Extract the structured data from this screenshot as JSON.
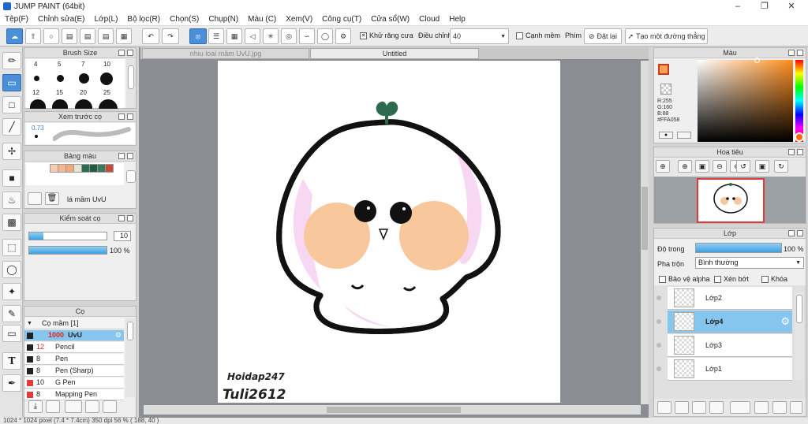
{
  "window": {
    "title": "JUMP PAINT (64bit)"
  },
  "menu": [
    "Tệp(F)",
    "Chỉnh sửa(E)",
    "Lớp(L)",
    "Bộ lọc(R)",
    "Chọn(S)",
    "Chụp(N)",
    "Màu (C)",
    "Xem(V)",
    "Công cụ(T)",
    "Cửa sổ(W)",
    "Cloud",
    "Help"
  ],
  "toolbar": {
    "antialias_label": "Khử răng cưa",
    "adjust_label": "Điều chỉnh",
    "adjust_value": "40",
    "soft_edge_label": "Cạnh mềm",
    "key_label": "Phím",
    "reset_label": "Đặt lại",
    "straight_line_label": "Tạo một đường thẳng"
  },
  "tabs": [
    {
      "label": "nhiu loai mầm UvU.jpg"
    },
    {
      "label": "Untitled"
    }
  ],
  "brush_size": {
    "title": "Brush Size",
    "row1": [
      "4",
      "5",
      "7",
      "10"
    ],
    "row2": [
      "12",
      "15",
      "20",
      "25"
    ]
  },
  "preview": {
    "title": "Xem trước cọ",
    "value": "0.73"
  },
  "palette": {
    "title": "Bảng màu",
    "name": "lá mầm UvU",
    "colors": [
      "#f6cdb0",
      "#f4b78e",
      "#f2a97a",
      "#e8e2d4",
      "#2d6b50",
      "#245a42",
      "#3a7a5c",
      "#c24b3e"
    ]
  },
  "brush_control": {
    "title": "Kiểm soát cọ",
    "size": "10",
    "opacity": "100 %"
  },
  "brushes": {
    "title": "Cọ",
    "group": "Cọ mầm [1]",
    "items": [
      {
        "num": "1000",
        "name": "UvU",
        "color": "#222222",
        "selected": true
      },
      {
        "num": "12",
        "name": "Pencil",
        "color": "#222222"
      },
      {
        "num": "8",
        "name": "Pen",
        "color": "#222222"
      },
      {
        "num": "8",
        "name": "Pen (Sharp)",
        "color": "#222222"
      },
      {
        "num": "10",
        "name": "G Pen",
        "color": "#e23b3b"
      },
      {
        "num": "8",
        "name": "Mapping Pen",
        "color": "#e23b3b"
      }
    ]
  },
  "color_panel": {
    "title": "Màu",
    "r": "R:255",
    "g": "G:160",
    "b": "B:88",
    "hex": "#FFA058",
    "fg_color": "#FFA058"
  },
  "navigator": {
    "title": "Hoa tiêu"
  },
  "layers": {
    "title": "Lớp",
    "opacity_label": "Độ trong",
    "opacity_value": "100 %",
    "opacity_fraction": 1.0,
    "blend_label": "Pha trộn",
    "blend_value": "Bình thường",
    "protect_alpha": "Bảo vệ alpha",
    "clip": "Xén bớt",
    "lock": "Khóa",
    "items": [
      {
        "name": "Lớp2",
        "selected": false
      },
      {
        "name": "Lớp4",
        "selected": true
      },
      {
        "name": "Lớp3",
        "selected": false
      },
      {
        "name": "Lớp1",
        "selected": false
      }
    ]
  },
  "canvas": {
    "signature_line1": "Hoidap247",
    "signature_line2": "Tuli2612"
  },
  "status": "1024 * 1024 pixel   (7.4 * 7.4cm)   350 dpi   56 %   ( 188, 40 )"
}
